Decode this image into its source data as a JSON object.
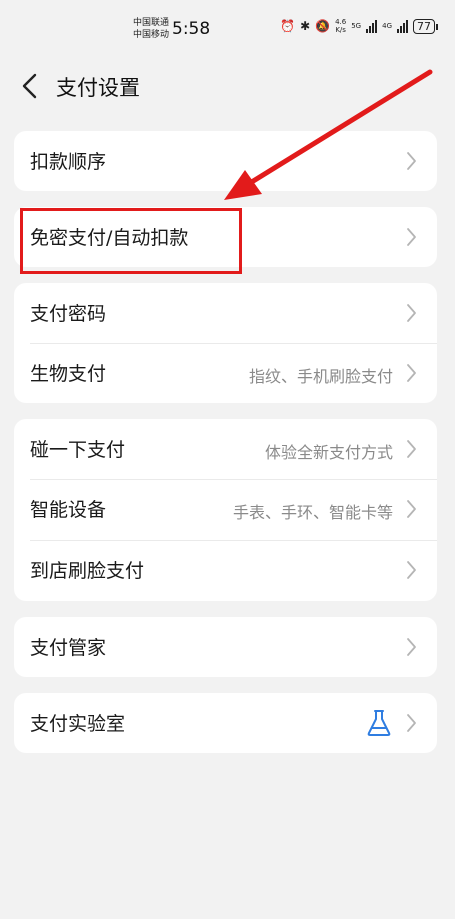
{
  "status_bar": {
    "carrier1": "中国联通",
    "carrier2": "中国移动",
    "time": "5:58",
    "speed": "4.6\nK/s",
    "net1": "5G",
    "net2": "4G",
    "battery": "77"
  },
  "header": {
    "title": "支付设置"
  },
  "groups": [
    {
      "items": [
        {
          "label": "扣款顺序"
        }
      ]
    },
    {
      "items": [
        {
          "label": "免密支付/自动扣款"
        }
      ]
    },
    {
      "items": [
        {
          "label": "支付密码"
        },
        {
          "label": "生物支付",
          "value": "指纹、手机刷脸支付"
        }
      ]
    },
    {
      "items": [
        {
          "label": "碰一下支付",
          "value": "体验全新支付方式"
        },
        {
          "label": "智能设备",
          "value": "手表、手环、智能卡等"
        },
        {
          "label": "到店刷脸支付"
        }
      ]
    },
    {
      "items": [
        {
          "label": "支付管家"
        }
      ]
    },
    {
      "items": [
        {
          "label": "支付实验室"
        }
      ]
    }
  ],
  "colors": {
    "annotation": "#e21b1b",
    "flask_icon": "#2f7de1"
  }
}
